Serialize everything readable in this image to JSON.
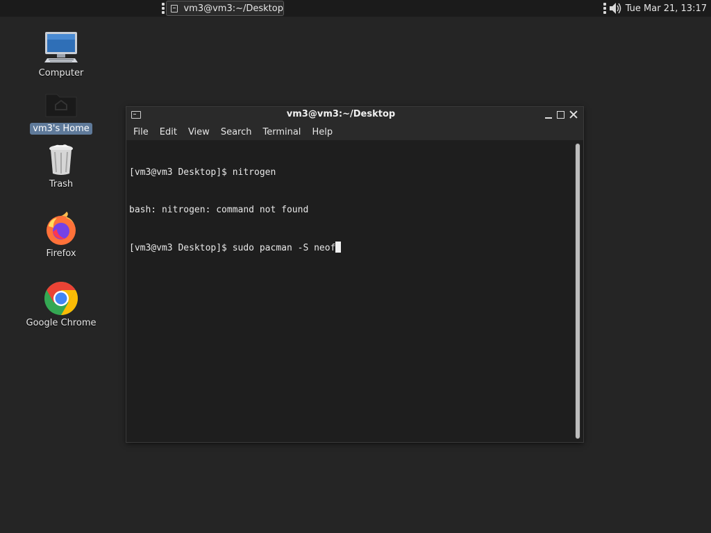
{
  "top_panel": {
    "taskbar_item": {
      "label": "vm3@vm3:~/Desktop",
      "icon": "terminal-icon"
    },
    "tray": {
      "volume_icon": "speaker-icon"
    },
    "clock": "Tue Mar 21, 13:17"
  },
  "desktop": {
    "icons": [
      {
        "label": "Computer",
        "icon": "computer-icon",
        "selected": false
      },
      {
        "label": "vm3's Home",
        "icon": "home-folder-icon",
        "selected": true
      },
      {
        "label": "Trash",
        "icon": "trash-icon",
        "selected": false
      },
      {
        "label": "Firefox",
        "icon": "firefox-icon",
        "selected": false
      },
      {
        "label": "Google Chrome",
        "icon": "chrome-icon",
        "selected": false
      }
    ]
  },
  "terminal": {
    "title": "vm3@vm3:~/Desktop",
    "menu": [
      "File",
      "Edit",
      "View",
      "Search",
      "Terminal",
      "Help"
    ],
    "lines": [
      "[vm3@vm3 Desktop]$ nitrogen",
      "bash: nitrogen: command not found",
      "[vm3@vm3 Desktop]$ sudo pacman -S neof"
    ]
  },
  "colors": {
    "desktop_background": "#252525",
    "panel_background": "#1b1b1b",
    "selection": "#5f7a9a",
    "terminal_background": "#1e1e1e"
  }
}
